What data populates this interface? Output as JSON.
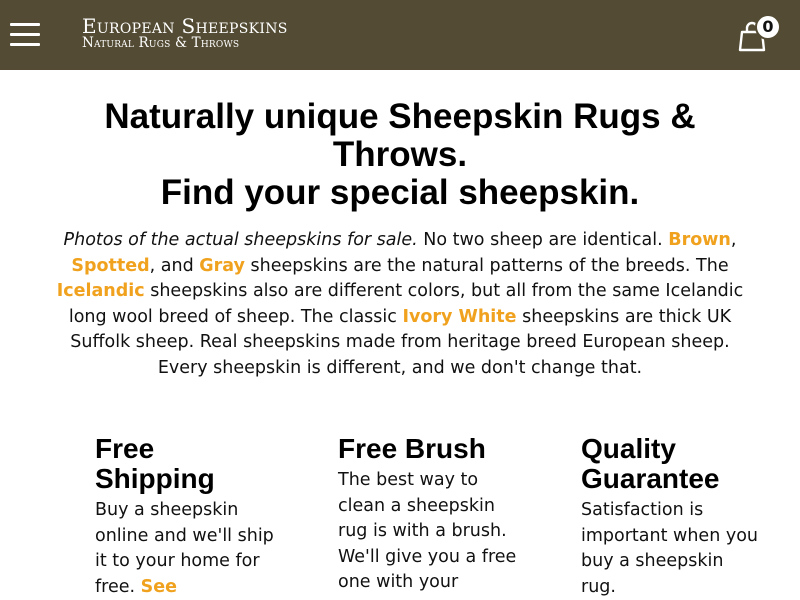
{
  "header": {
    "logo_line1": "European Sheepskins",
    "logo_line2": "Natural Rugs & Throws",
    "cart_count": "0",
    "colors": {
      "bar": "#534b33",
      "text": "#ffffff"
    }
  },
  "hero": {
    "title_line1": "Naturally unique Sheepskin Rugs & Throws.",
    "title_line2": "Find your special sheepskin."
  },
  "intro": {
    "italic_lead": "Photos of the actual sheepskins for sale.",
    "t1": " No two sheep are identical. ",
    "link_brown": "Brown",
    "t2": ", ",
    "link_spotted": "Spotted",
    "t3": ", and ",
    "link_gray": "Gray",
    "t4": " sheepskins are the natural patterns of the breeds. The ",
    "link_icelandic": "Icelandic",
    "t5": " sheepskins also are different colors, but all from the same Icelandic long wool breed of sheep. The classic ",
    "link_ivory": "Ivory White",
    "t6": " sheepskins are thick UK Suffolk sheep. Real sheepskins made from heritage breed European sheep. Every sheepskin is different, and we don't change that.",
    "link_color": "#f0a21e"
  },
  "features": {
    "shipping": {
      "title": "Free Shipping",
      "text": "Buy a sheepskin online and we'll ship it to your home for free. ",
      "link": "See"
    },
    "brush": {
      "title": "Free Brush",
      "text": "The best way to clean a sheepskin rug is with a brush. We'll give you a free one with your"
    },
    "guarantee": {
      "title": "Quality Guarantee",
      "text": "Satisfaction is important when you buy a sheepskin rug."
    }
  },
  "icons": {
    "menu": "hamburger-menu-icon",
    "cart": "shopping-bag-icon"
  }
}
